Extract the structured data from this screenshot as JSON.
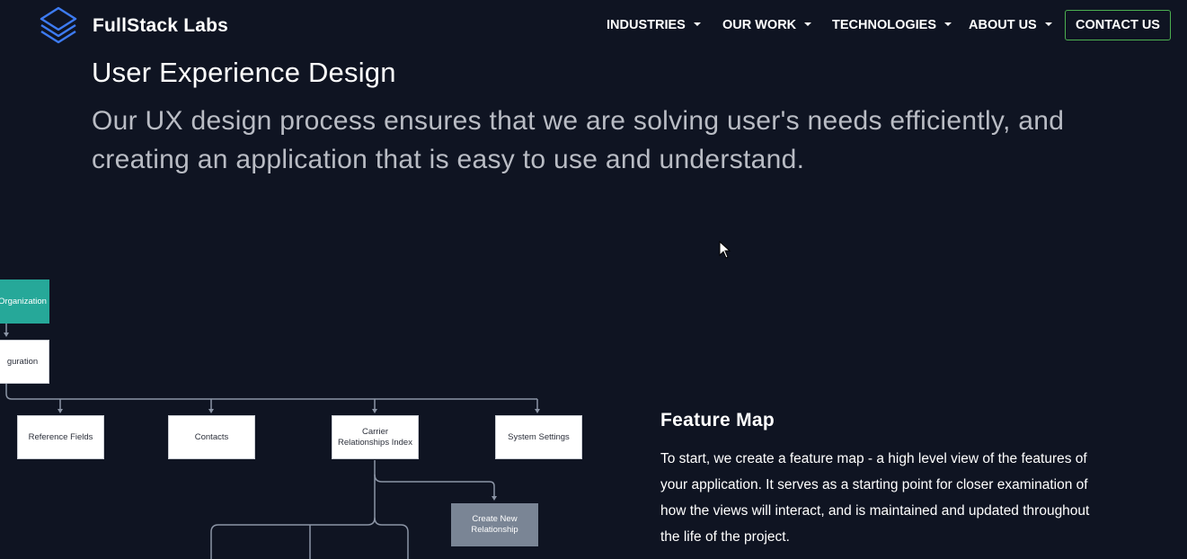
{
  "header": {
    "brand": "FullStack Labs",
    "nav": [
      {
        "label": "INDUSTRIES"
      },
      {
        "label": "OUR WORK"
      },
      {
        "label": "TECHNOLOGIES"
      },
      {
        "label": "ABOUT US"
      }
    ],
    "contact_label": "CONTACT US"
  },
  "hero": {
    "title": "User Experience Design",
    "description": "Our UX design process ensures that we are solving user's needs efficiently, and creating an application that is easy to use and understand."
  },
  "diagram": {
    "nodes": {
      "organization": "Organization",
      "configuration": "guration",
      "reference_fields": "Reference Fields",
      "contacts": "Contacts",
      "carrier_relationships_index": "Carrier Relationships Index",
      "system_settings": "System Settings",
      "create_new_relationship": "Create New Relationship"
    }
  },
  "feature_map": {
    "title": "Feature Map",
    "text": "To start, we create a feature map - a high level view of the features of your application. It serves as a starting point for closer examination of how the views will interact, and is maintained and updated throughout the life of the project."
  },
  "colors": {
    "background": "#0f1422",
    "accent_green": "#4caf50",
    "teal_node": "#26a899",
    "grey_node": "#7a8595",
    "logo_blue": "#3d7bf2"
  },
  "icons": {
    "logo": "stacked-layers-icon",
    "caret": "caret-down-icon",
    "cursor": "mouse-pointer-icon"
  }
}
